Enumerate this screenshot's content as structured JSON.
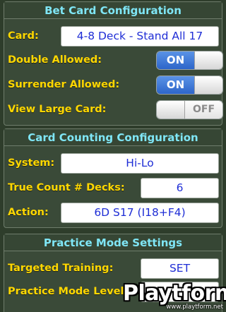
{
  "bet_card": {
    "header": "Bet Card Configuration",
    "card_label": "Card:",
    "card_value": "4-8 Deck - Stand All 17",
    "double_label": "Double Allowed:",
    "double_toggle": "ON",
    "surrender_label": "Surrender Allowed:",
    "surrender_toggle": "ON",
    "large_card_label": "View Large Card:",
    "large_card_toggle": "OFF"
  },
  "card_counting": {
    "header": "Card Counting Configuration",
    "system_label": "System:",
    "system_value": "Hi-Lo",
    "decks_label": "True Count # Decks:",
    "decks_value": "6",
    "action_label": "Action:",
    "action_value": "6D S17 (I18+F4)"
  },
  "practice": {
    "header": "Practice Mode Settings",
    "targeted_label": "Targeted Training:",
    "targeted_value": "SET",
    "level_label": "Practice Mode Level:"
  },
  "watermark": {
    "brand": "Playtform",
    "url": "www.playtform.net"
  },
  "colors": {
    "background": "#2e3d2b",
    "header_text": "#7fe6f6",
    "label_text": "#ffd700",
    "value_text": "#1f2ed6",
    "toggle_on": "#2d65c9"
  }
}
